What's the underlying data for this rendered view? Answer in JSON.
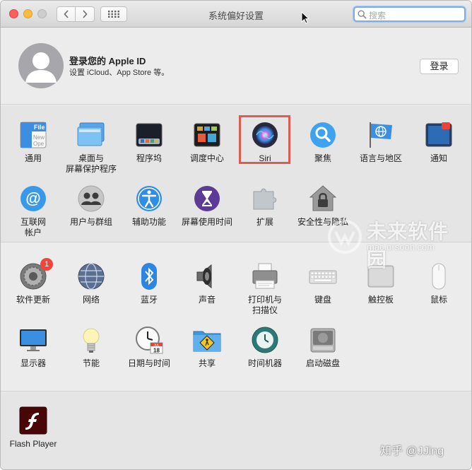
{
  "window": {
    "title": "系统偏好设置"
  },
  "search": {
    "placeholder": "搜索"
  },
  "account": {
    "title": "登录您的 Apple ID",
    "subtitle": "设置 iCloud、App Store 等。",
    "login_label": "登录"
  },
  "row1": [
    {
      "name": "general",
      "label": "通用",
      "icon": "general-icon"
    },
    {
      "name": "desktop",
      "label": "桌面与\n屏幕保护程序",
      "icon": "desktop-icon"
    },
    {
      "name": "dock",
      "label": "程序坞",
      "icon": "dock-icon"
    },
    {
      "name": "mission-control",
      "label": "调度中心",
      "icon": "mission-control-icon"
    },
    {
      "name": "siri",
      "label": "Siri",
      "icon": "siri-icon"
    },
    {
      "name": "spotlight",
      "label": "聚焦",
      "icon": "spotlight-icon"
    },
    {
      "name": "language",
      "label": "语言与地区",
      "icon": "language-icon"
    },
    {
      "name": "notifications",
      "label": "通知",
      "icon": "notifications-icon"
    }
  ],
  "row2": [
    {
      "name": "internet-accounts",
      "label": "互联网\n帐户",
      "icon": "at-icon"
    },
    {
      "name": "users",
      "label": "用户与群组",
      "icon": "users-icon"
    },
    {
      "name": "accessibility",
      "label": "辅助功能",
      "icon": "accessibility-icon"
    },
    {
      "name": "screen-time",
      "label": "屏幕使用时间",
      "icon": "hourglass-icon"
    },
    {
      "name": "extensions",
      "label": "扩展",
      "icon": "puzzle-icon"
    },
    {
      "name": "security",
      "label": "安全性与隐私",
      "icon": "house-lock-icon"
    }
  ],
  "row3": [
    {
      "name": "software-update",
      "label": "软件更新",
      "icon": "gear-icon",
      "badge": "1"
    },
    {
      "name": "network",
      "label": "网络",
      "icon": "globe-icon"
    },
    {
      "name": "bluetooth",
      "label": "蓝牙",
      "icon": "bluetooth-icon"
    },
    {
      "name": "sound",
      "label": "声音",
      "icon": "speaker-icon"
    },
    {
      "name": "printers",
      "label": "打印机与\n扫描仪",
      "icon": "printer-icon"
    },
    {
      "name": "keyboard",
      "label": "键盘",
      "icon": "keyboard-icon"
    },
    {
      "name": "trackpad",
      "label": "触控板",
      "icon": "trackpad-icon"
    },
    {
      "name": "mouse",
      "label": "鼠标",
      "icon": "mouse-icon"
    }
  ],
  "row4": [
    {
      "name": "displays",
      "label": "显示器",
      "icon": "display-icon"
    },
    {
      "name": "energy",
      "label": "节能",
      "icon": "bulb-icon"
    },
    {
      "name": "date-time",
      "label": "日期与时间",
      "icon": "clock-icon"
    },
    {
      "name": "sharing",
      "label": "共享",
      "icon": "sharing-folder-icon"
    },
    {
      "name": "time-machine",
      "label": "时间机器",
      "icon": "time-machine-icon"
    },
    {
      "name": "startup-disk",
      "label": "启动磁盘",
      "icon": "disk-icon"
    }
  ],
  "row5": [
    {
      "name": "flash-player",
      "label": "Flash Player",
      "icon": "flash-icon"
    }
  ],
  "watermark": {
    "text": "未来软件园",
    "url": "mac.orsoon.com"
  },
  "credit": "知乎 @JJing",
  "calendar": {
    "month": "JUL",
    "day": "18"
  }
}
